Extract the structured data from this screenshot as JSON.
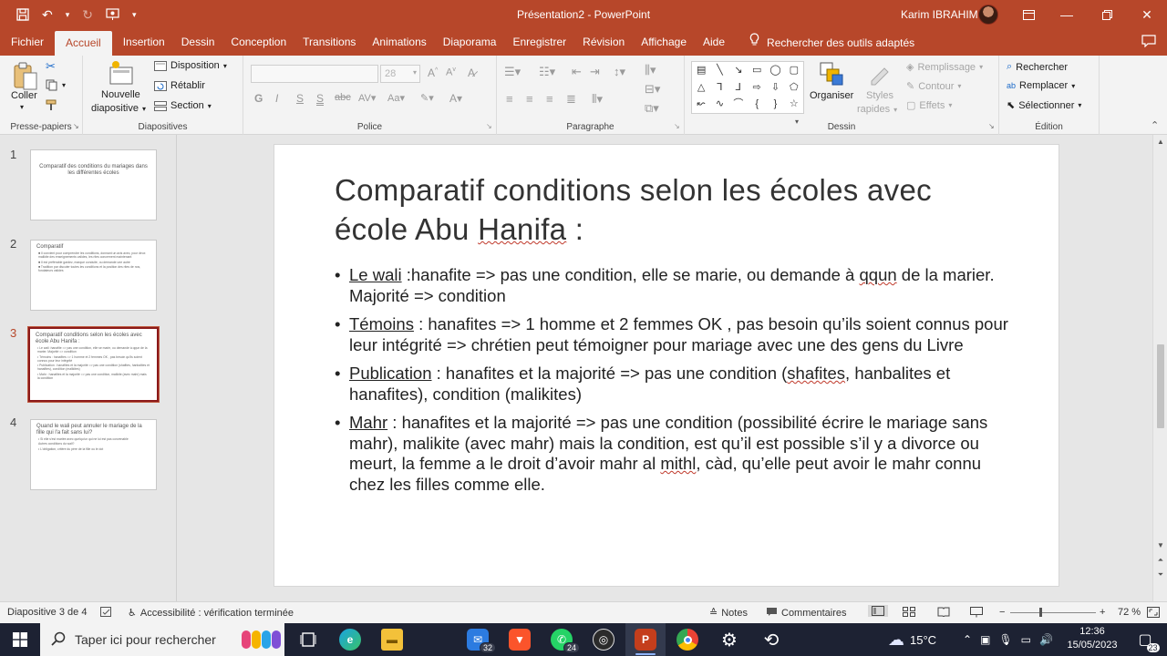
{
  "window": {
    "title": "Présentation2  -  PowerPoint",
    "user": "Karim IBRAHIM"
  },
  "tabs": [
    "Fichier",
    "Accueil",
    "Insertion",
    "Dessin",
    "Conception",
    "Transitions",
    "Animations",
    "Diaporama",
    "Enregistrer",
    "Révision",
    "Affichage",
    "Aide"
  ],
  "active_tab": "Accueil",
  "tell_me": "Rechercher des outils adaptés",
  "ribbon": {
    "clipboard": {
      "paste": "Coller",
      "group": "Presse-papiers"
    },
    "slides": {
      "new_slide_1": "Nouvelle",
      "new_slide_2": "diapositive",
      "layout": "Disposition",
      "reset": "Rétablir",
      "section": "Section",
      "group": "Diapositives"
    },
    "font": {
      "size": "28",
      "bold": "G",
      "italic": "I",
      "underline": "S",
      "strike": "S",
      "group": "Police"
    },
    "paragraph": {
      "group": "Paragraphe"
    },
    "drawing": {
      "arrange": "Organiser",
      "styles_1": "Styles",
      "styles_2": "rapides",
      "fill": "Remplissage",
      "outline": "Contour",
      "effects": "Effets",
      "group": "Dessin"
    },
    "editing": {
      "find": "Rechercher",
      "replace": "Remplacer",
      "select": "Sélectionner",
      "group": "Édition"
    }
  },
  "thumbnails": [
    {
      "num": "1",
      "title": "Comparatif des conditions du mariages dans les différentes écoles",
      "lines": []
    },
    {
      "num": "2",
      "title": "Comparatif",
      "lines": [
        "■ Il convient pour comprendre les conditions, donnant un avis avec, pour deux malikite des enseignements valides, les rites concernent maintenant",
        "■ Il est préférable gardez, marque conduite, ou demande une autre",
        "■ Tradition par discuter toutes les conditions et la position des rites de nos, fondateurs valides"
      ]
    },
    {
      "num": "3",
      "title": "Comparatif conditions selon les écoles avec école Abu Hanifa :",
      "lines": [
        "• Le wali :hanafite => pas une condition, elle se marie, ou demande à qqun de la marier. Majorité => condition",
        "• Témoins : hanafites => 1 homme et 2 femmes OK , pas besoin qu'ils soient connus pour leur intégrité",
        "• Publication : hanafites et la majorité => pas une condition (shafites, hanbalites et hanafites), condition (malikites)",
        "• Mahr : hanafites et la majorité => pas une condition, malikite (avec mahr) mais la condition"
      ]
    },
    {
      "num": "4",
      "title": "Quand le wali peut annuler le mariage de la fille qui l'a fait sans lui?",
      "lines": [
        "• Si elle s'est mariée avec quelqu'un qui ne lui est pas convenable",
        "Autres conditions du wali?",
        "• L'obligation, critère du père de la fille ou le dot"
      ]
    }
  ],
  "active_slide_index": 2,
  "slide": {
    "title_line1": "Comparatif conditions selon les écoles avec",
    "title_line2_a": "école Abu ",
    "title_line2_b": "Hanifa",
    "title_line2_c": " :",
    "bullets": [
      {
        "key": "Le wali",
        "a": " :hanafite => pas une condition, elle se marie, ou demande à ",
        "w": "qqun",
        "b": " de la marier. Majorité => condition"
      },
      {
        "key": "Témoins",
        "a": " : hanafites => 1 homme et 2 femmes OK , pas besoin qu’ils soient connus pour leur intégrité => chrétien peut témoigner pour mariage avec une des gens du Livre",
        "w": "",
        "b": ""
      },
      {
        "key": "Publication",
        "a": " : hanafites et la majorité => pas une condition (",
        "w": "shafites",
        "b": ", hanbalites et hanafites), condition (malikites)"
      },
      {
        "key": "Mahr",
        "a": " : hanafites et la majorité => pas une condition (possibilité écrire le mariage sans mahr), malikite (avec mahr) mais la condition, est qu’il est possible s’il y a divorce ou meurt, la femme a le droit d’avoir mahr al ",
        "w": "mithl",
        "b": ", càd, qu’elle peut avoir le mahr connu chez les filles comme elle."
      }
    ]
  },
  "status": {
    "slide_counter": "Diapositive 3 de 4",
    "accessibility": "Accessibilité : vérification terminée",
    "notes": "Notes",
    "comments": "Commentaires",
    "zoom": "72 %"
  },
  "taskbar": {
    "search_placeholder": "Taper ici pour rechercher",
    "mail_badge": "32",
    "whatsapp_badge": "24",
    "temperature": "15°C",
    "time": "12:36",
    "date": "15/05/2023",
    "notif_count": "23"
  },
  "colors": {
    "accent": "#b7472a",
    "active_border": "#8b1a1a",
    "taskbar": "#1d2233"
  }
}
